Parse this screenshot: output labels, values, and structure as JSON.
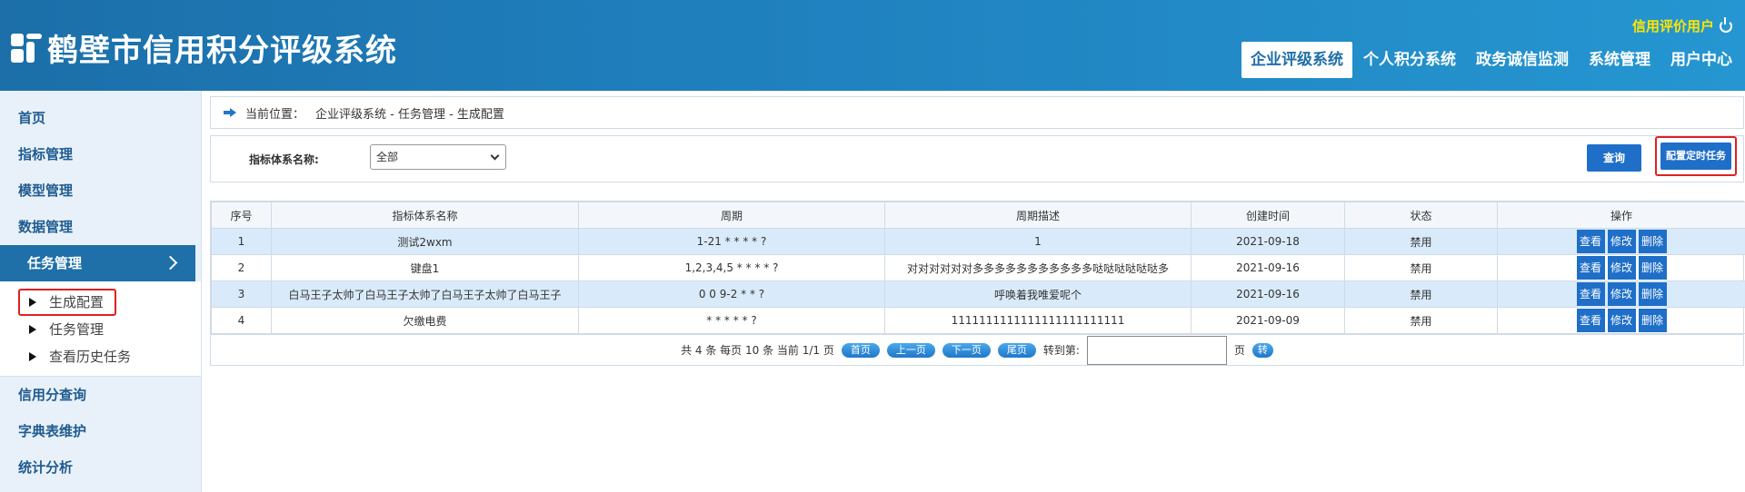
{
  "header": {
    "title": "鹤壁市信用积分评级系统",
    "user": "信用评价用户",
    "nav": [
      "企业评级系统",
      "个人积分系统",
      "政务诚信监测",
      "系统管理",
      "用户中心"
    ]
  },
  "sidebar": {
    "items_top": [
      "首页",
      "指标管理",
      "模型管理",
      "数据管理"
    ],
    "active": "任务管理",
    "sub_items": [
      "生成配置",
      "任务管理",
      "查看历史任务"
    ],
    "items_bottom": [
      "信用分查询",
      "字典表维护",
      "统计分析"
    ]
  },
  "breadcrumb": {
    "label": "当前位置：",
    "path": "企业评级系统 - 任务管理 - 生成配置"
  },
  "filter": {
    "label": "指标体系名称:",
    "selected": "全部",
    "query_label": "查询",
    "config_label": "配置定时任务"
  },
  "table": {
    "headers": [
      "序号",
      "指标体系名称",
      "周期",
      "周期描述",
      "创建时间",
      "状态",
      "操作"
    ],
    "rows": [
      {
        "no": "1",
        "name": "测试2wxm",
        "cycle": "1-21 * * * * ?",
        "desc": "1",
        "created": "2021-09-18",
        "status": "禁用"
      },
      {
        "no": "2",
        "name": "键盘1",
        "cycle": "1,2,3,4,5 * * * * ?",
        "desc": "对对对对对对多多多多多多多多多多多哒哒哒哒哒哒多",
        "created": "2021-09-16",
        "status": "禁用"
      },
      {
        "no": "3",
        "name": "白马王子太帅了白马王子太帅了白马王子太帅了白马王子",
        "cycle": "0 0 9-2 * * ?",
        "desc": "呼唤着我唯爱呢个",
        "created": "2021-09-16",
        "status": "禁用"
      },
      {
        "no": "4",
        "name": "欠缴电费",
        "cycle": "* * * * * ?",
        "desc": "1111111111111111111111111",
        "created": "2021-09-09",
        "status": "禁用"
      }
    ],
    "ops": [
      "查看",
      "修改",
      "删除"
    ]
  },
  "pager": {
    "summary": "共 4 条 每页 10 条 当前 1/1 页",
    "first": "首页",
    "prev": "上一页",
    "next": "下一页",
    "last": "尾页",
    "jump_label": "转到第:",
    "page_unit": "页",
    "go": "转"
  }
}
